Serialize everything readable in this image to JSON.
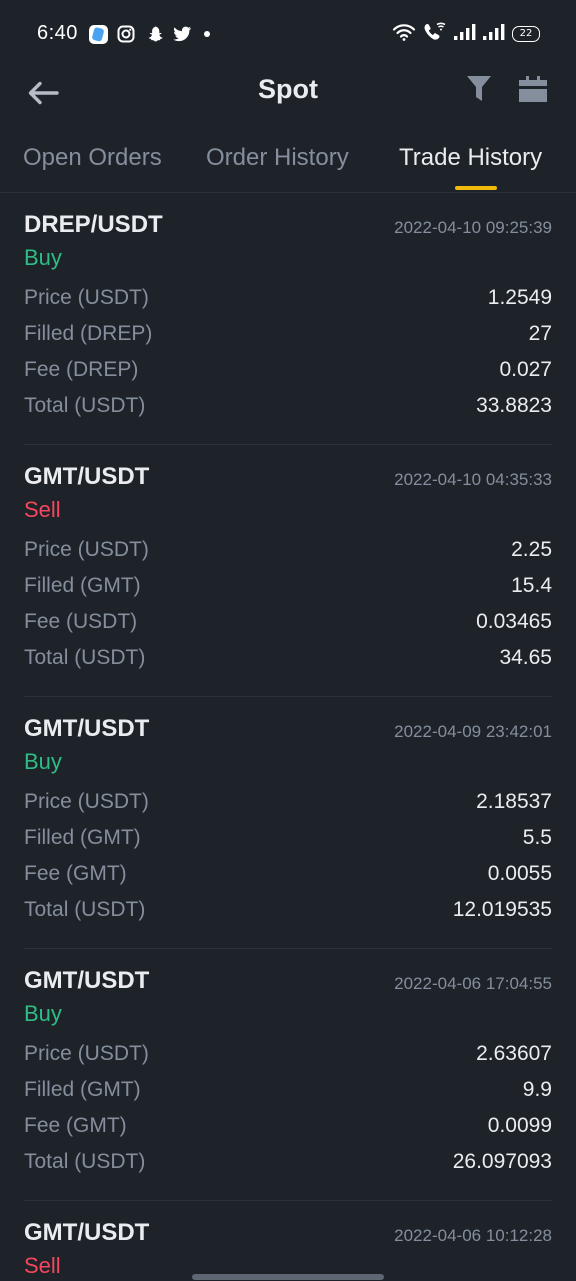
{
  "status_bar": {
    "time": "6:40",
    "battery": "22"
  },
  "header": {
    "title": "Spot"
  },
  "tabs": [
    {
      "label": "Open Orders",
      "active": false
    },
    {
      "label": "Order History",
      "active": false
    },
    {
      "label": "Trade History",
      "active": true
    }
  ],
  "colors": {
    "background": "#1e2329",
    "accent": "#f0b90b",
    "buy": "#2ebd85",
    "sell": "#f6465d",
    "muted": "#848e9c"
  },
  "trades": [
    {
      "pair": "DREP/USDT",
      "side": "Buy",
      "time": "2022-04-10 09:25:39",
      "rows": [
        {
          "label": "Price (USDT)",
          "value": "1.2549"
        },
        {
          "label": "Filled (DREP)",
          "value": "27"
        },
        {
          "label": "Fee (DREP)",
          "value": "0.027"
        },
        {
          "label": "Total (USDT)",
          "value": "33.8823"
        }
      ]
    },
    {
      "pair": "GMT/USDT",
      "side": "Sell",
      "time": "2022-04-10 04:35:33",
      "rows": [
        {
          "label": "Price (USDT)",
          "value": "2.25"
        },
        {
          "label": "Filled (GMT)",
          "value": "15.4"
        },
        {
          "label": "Fee (USDT)",
          "value": "0.03465"
        },
        {
          "label": "Total (USDT)",
          "value": "34.65"
        }
      ]
    },
    {
      "pair": "GMT/USDT",
      "side": "Buy",
      "time": "2022-04-09 23:42:01",
      "rows": [
        {
          "label": "Price (USDT)",
          "value": "2.18537"
        },
        {
          "label": "Filled (GMT)",
          "value": "5.5"
        },
        {
          "label": "Fee (GMT)",
          "value": "0.0055"
        },
        {
          "label": "Total (USDT)",
          "value": "12.019535"
        }
      ]
    },
    {
      "pair": "GMT/USDT",
      "side": "Buy",
      "time": "2022-04-06 17:04:55",
      "rows": [
        {
          "label": "Price (USDT)",
          "value": "2.63607"
        },
        {
          "label": "Filled (GMT)",
          "value": "9.9"
        },
        {
          "label": "Fee (GMT)",
          "value": "0.0099"
        },
        {
          "label": "Total (USDT)",
          "value": "26.097093"
        }
      ]
    },
    {
      "pair": "GMT/USDT",
      "side": "Sell",
      "time": "2022-04-06 10:12:28",
      "rows": []
    }
  ]
}
